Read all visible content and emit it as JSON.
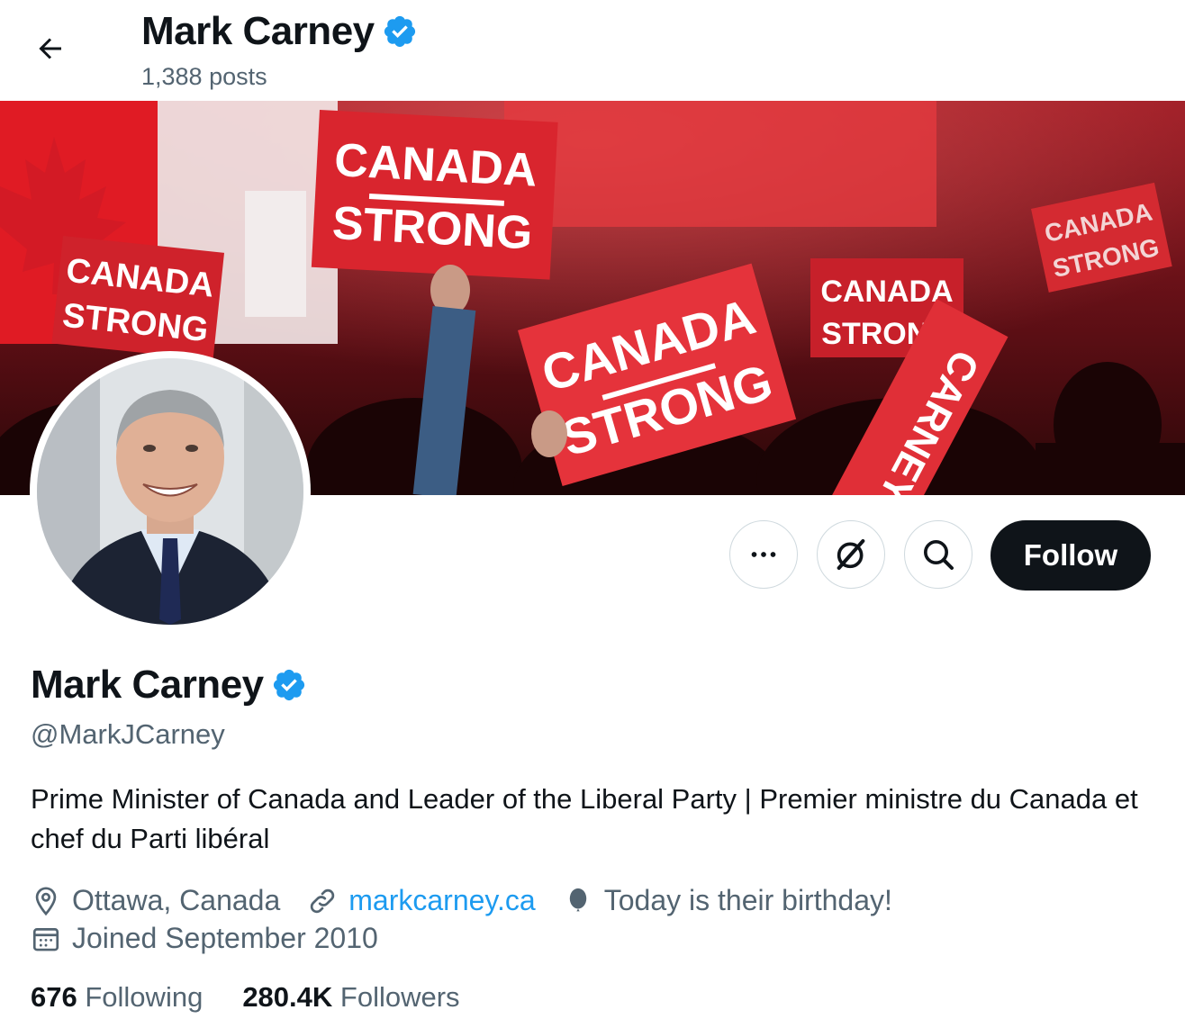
{
  "header": {
    "display_name": "Mark Carney",
    "post_count": "1,388 posts"
  },
  "banner": {
    "signs": [
      "CANADA",
      "STRONG",
      "CARNEY"
    ]
  },
  "actions": {
    "follow_label": "Follow"
  },
  "profile": {
    "display_name": "Mark Carney",
    "handle": "@MarkJCarney",
    "bio": "Prime Minister of Canada and Leader of the Liberal Party | Premier ministre du Canada et chef du Parti libéral",
    "location": "Ottawa, Canada",
    "website": "markcarney.ca",
    "birthday": "Today is their birthday!",
    "joined": "Joined September 2010"
  },
  "stats": {
    "following_count": "676",
    "following_label": "Following",
    "followers_count": "280.4K",
    "followers_label": "Followers"
  },
  "colors": {
    "verified": "#1d9bf0",
    "link": "#1d9bf0",
    "follow_bg": "#0f1419",
    "secondary_text": "#536471",
    "banner_red": "#c8102e"
  },
  "icons": [
    "back-arrow-icon",
    "verified-badge-icon",
    "more-icon",
    "grok-icon",
    "search-icon",
    "location-icon",
    "link-icon",
    "balloon-icon",
    "calendar-icon"
  ]
}
